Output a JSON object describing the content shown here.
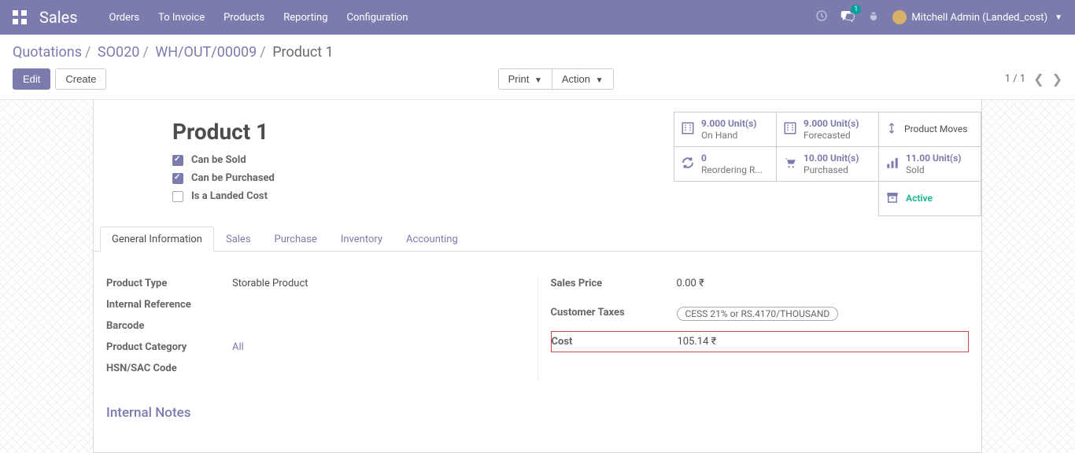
{
  "topnav": {
    "brand": "Sales",
    "menu": [
      "Orders",
      "To Invoice",
      "Products",
      "Reporting",
      "Configuration"
    ],
    "messaging_badge": "1",
    "user": "Mitchell Admin (Landed_cost)"
  },
  "breadcrumb": {
    "items": [
      "Quotations",
      "SO020",
      "WH/OUT/00009"
    ],
    "current": "Product 1"
  },
  "buttons": {
    "edit": "Edit",
    "create": "Create",
    "print": "Print",
    "action": "Action"
  },
  "pager": {
    "text": "1 / 1"
  },
  "product": {
    "title": "Product 1",
    "checks": {
      "can_be_sold": "Can be Sold",
      "can_be_purchased": "Can be Purchased",
      "is_landed_cost": "Is a Landed Cost"
    }
  },
  "stats": {
    "on_hand": {
      "value": "9.000 Unit(s)",
      "label": "On Hand"
    },
    "forecasted": {
      "value": "9.000 Unit(s)",
      "label": "Forecasted"
    },
    "moves": {
      "label": "Product Moves"
    },
    "reordering": {
      "value": "0",
      "label": "Reordering R..."
    },
    "purchased": {
      "value": "10.00 Unit(s)",
      "label": "Purchased"
    },
    "sold": {
      "value": "11.00 Unit(s)",
      "label": "Sold"
    },
    "active": {
      "value": "Active"
    }
  },
  "tabs": [
    "General Information",
    "Sales",
    "Purchase",
    "Inventory",
    "Accounting"
  ],
  "fields": {
    "left": {
      "product_type": {
        "label": "Product Type",
        "value": "Storable Product"
      },
      "internal_ref": {
        "label": "Internal Reference",
        "value": ""
      },
      "barcode": {
        "label": "Barcode",
        "value": ""
      },
      "category": {
        "label": "Product Category",
        "value": "All"
      },
      "hsn": {
        "label": "HSN/SAC Code",
        "value": ""
      }
    },
    "right": {
      "sales_price": {
        "label": "Sales Price",
        "value": "0.00 ₹"
      },
      "customer_taxes": {
        "label": "Customer Taxes",
        "value": "CESS 21% or RS.4170/THOUSAND"
      },
      "cost": {
        "label": "Cost",
        "value": "105.14 ₹"
      }
    }
  },
  "internal_notes": "Internal Notes"
}
